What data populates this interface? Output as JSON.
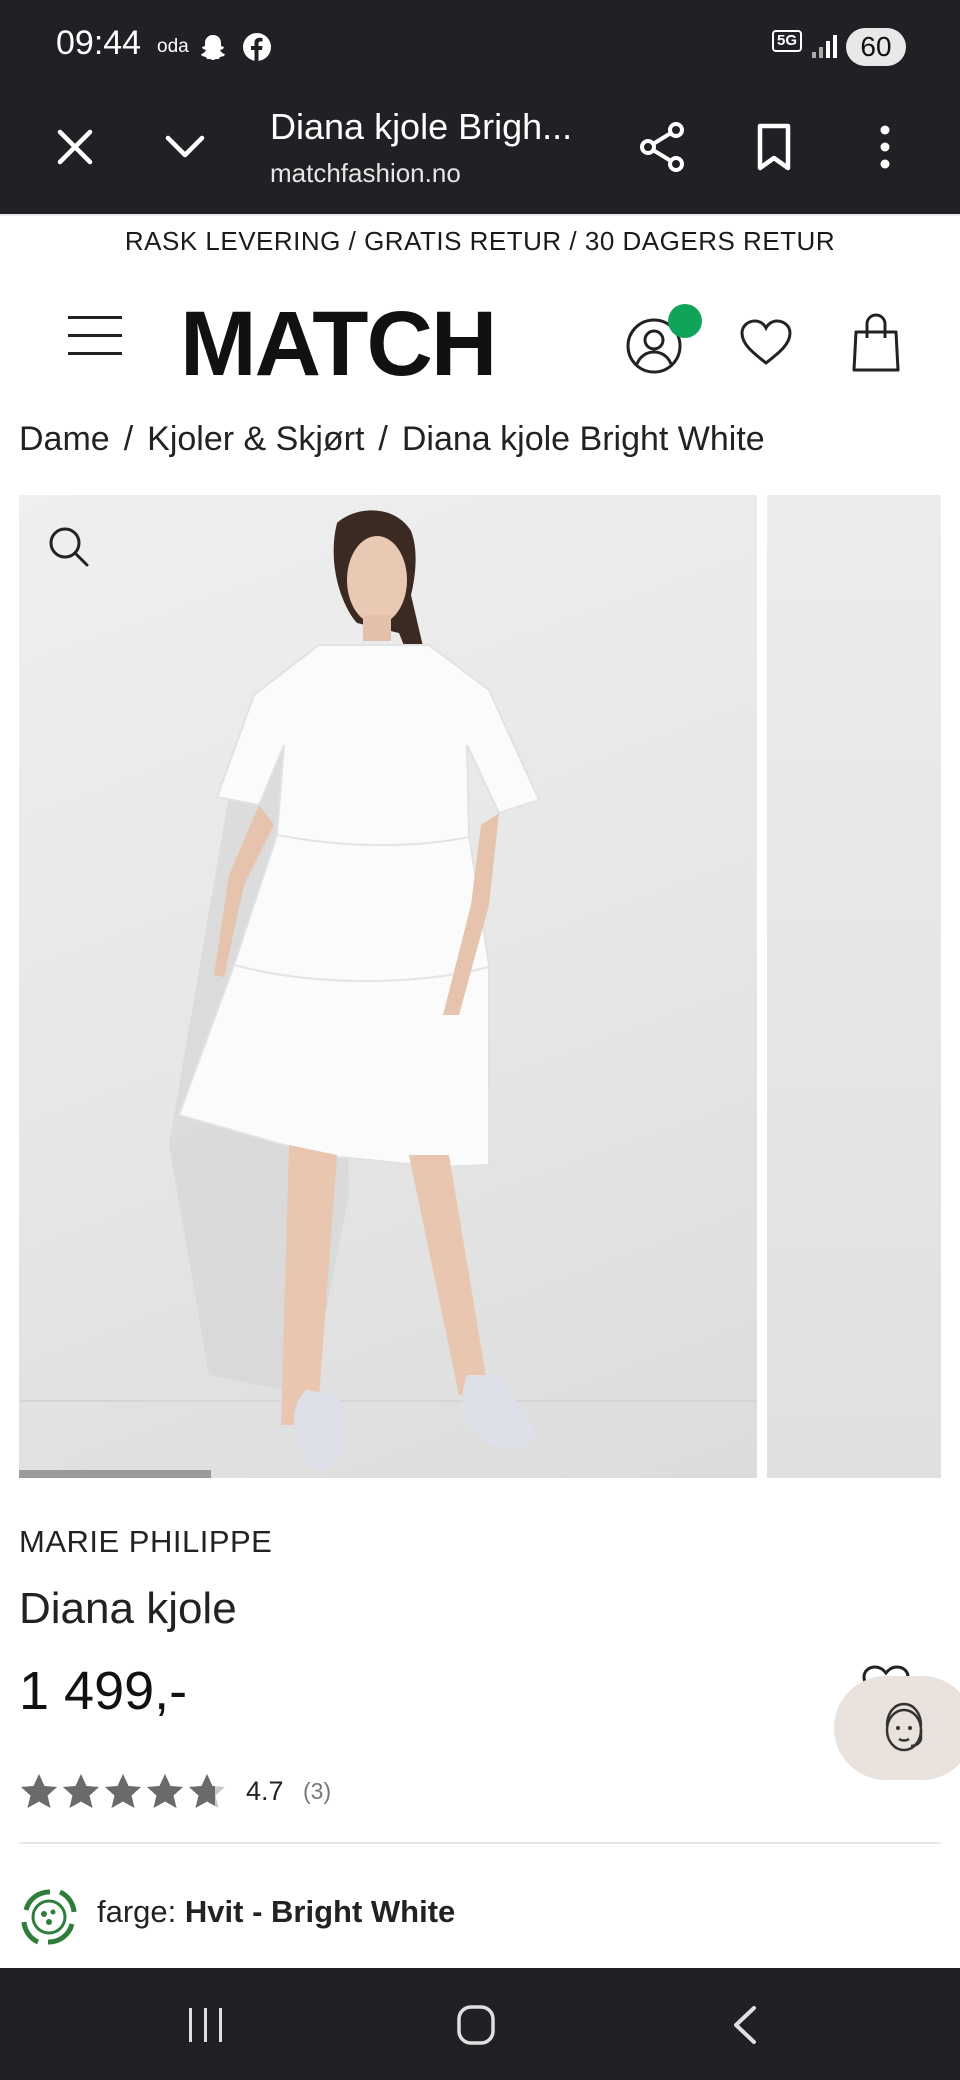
{
  "status_bar": {
    "time": "09:44",
    "carrier_app": "oda",
    "network": "5G",
    "battery": "60"
  },
  "browser": {
    "title": "Diana kjole Brigh...",
    "url": "matchfashion.no"
  },
  "promo_banner": "RASK LEVERING / GRATIS RETUR / 30 DAGERS RETUR",
  "header": {
    "logo": "MATCH",
    "accent_color": "#10a35a"
  },
  "breadcrumb": [
    "Dame",
    "Kjoler & Skjørt",
    "Diana kjole Bright White"
  ],
  "product": {
    "brand": "MARIE PHILIPPE",
    "name": "Diana kjole",
    "price": "1 499,-",
    "rating": "4.7",
    "rating_count": "(3)",
    "rating_stars": 4.7,
    "color_label": "farge:",
    "color_value": "Hvit - Bright White"
  },
  "gallery": {
    "progress": 0.26
  }
}
